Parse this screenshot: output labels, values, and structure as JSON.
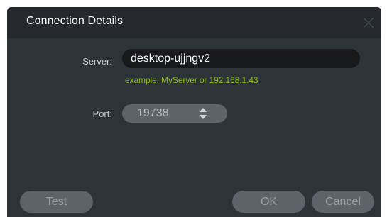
{
  "dialog": {
    "title": "Connection Details",
    "close_icon": "close-icon"
  },
  "server": {
    "label": "Server:",
    "value": "desktop-ujjngv2",
    "hint": "example: MyServer or 192.168.1.43"
  },
  "port": {
    "label": "Port:",
    "value": "19738",
    "stepper_icon": "up-down-arrows-icon"
  },
  "buttons": {
    "test": "Test",
    "ok": "OK",
    "cancel": "Cancel"
  },
  "colors": {
    "dialog_bg": "#2e3338",
    "titlebar_bg": "#25292d",
    "input_bg": "#17191c",
    "hint": "#8fbe14",
    "button_bg": "#5d6368"
  }
}
